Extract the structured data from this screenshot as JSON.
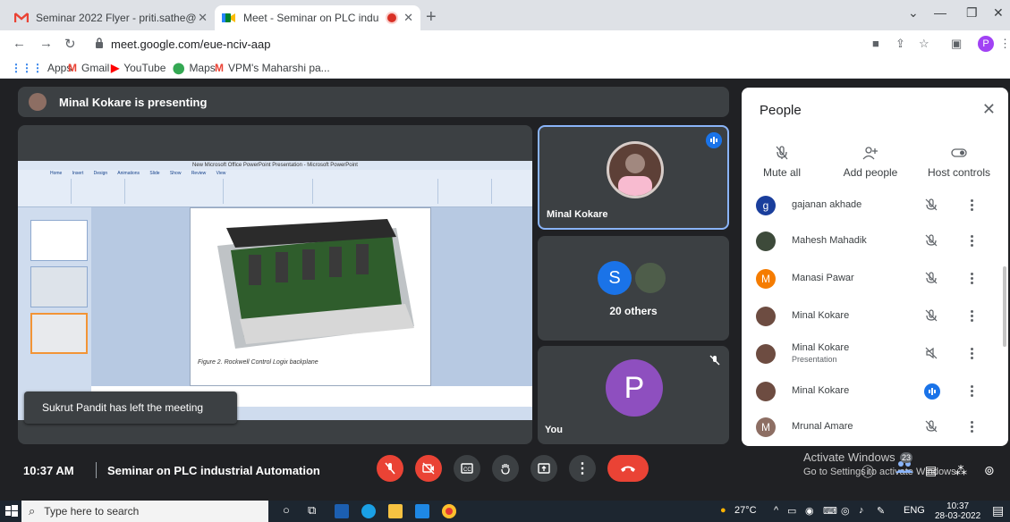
{
  "browser": {
    "tabs": [
      {
        "title": "Seminar 2022 Flyer - priti.sathe@",
        "active": false
      },
      {
        "title": "Meet - Seminar on PLC indu",
        "active": true
      }
    ],
    "url": "meet.google.com/eue-nciv-aap",
    "profile_initial": "P",
    "bookmarks": [
      "Apps",
      "Gmail",
      "YouTube",
      "Maps",
      "VPM's Maharshi pa..."
    ]
  },
  "meet": {
    "presenting_banner": "Minal Kokare is presenting",
    "toast": "Sukrut Pandit has left the meeting",
    "tiles": [
      {
        "name": "Minal Kokare"
      },
      {
        "label": "20 others",
        "initial": "S"
      },
      {
        "name": "You",
        "initial": "P"
      }
    ],
    "time": "10:37 AM",
    "meeting_title": "Seminar on PLC industrial Automation",
    "people_count": "23",
    "slide": {
      "app_title": "New Microsoft Office PowerPoint Presentation - Microsoft PowerPoint",
      "ribbon_tabs": "Home Insert Design Animations Slide Show Review View",
      "caption": "Figure 2. Rockwell Control Logix backplane"
    }
  },
  "people_panel": {
    "title": "People",
    "actions": [
      "Mute all",
      "Add people",
      "Host controls"
    ],
    "participants": [
      {
        "name": "gajanan akhade",
        "initial": "g",
        "color": "#1a3e9c",
        "sub": "",
        "state": "muted"
      },
      {
        "name": "Mahesh Mahadik",
        "initial": "",
        "color": "#3d4a3a",
        "sub": "",
        "state": "muted"
      },
      {
        "name": "Manasi Pawar",
        "initial": "M",
        "color": "#f57c00",
        "sub": "",
        "state": "muted"
      },
      {
        "name": "Minal Kokare",
        "initial": "",
        "color": "#6d4c41",
        "sub": "",
        "state": "muted"
      },
      {
        "name": "Minal Kokare",
        "initial": "",
        "color": "#6d4c41",
        "sub": "Presentation",
        "state": "audio-off"
      },
      {
        "name": "Minal Kokare",
        "initial": "",
        "color": "#6d4c41",
        "sub": "",
        "state": "speaking"
      },
      {
        "name": "Mrunal Amare",
        "initial": "M",
        "color": "#8d6e63",
        "sub": "",
        "state": "muted"
      }
    ]
  },
  "watermark": {
    "line1": "Activate Windows",
    "line2": "Go to Settings to activate Windows."
  },
  "taskbar": {
    "search_placeholder": "Type here to search",
    "weather": "27°C",
    "language": "ENG",
    "time": "10:37",
    "date": "28-03-2022"
  }
}
